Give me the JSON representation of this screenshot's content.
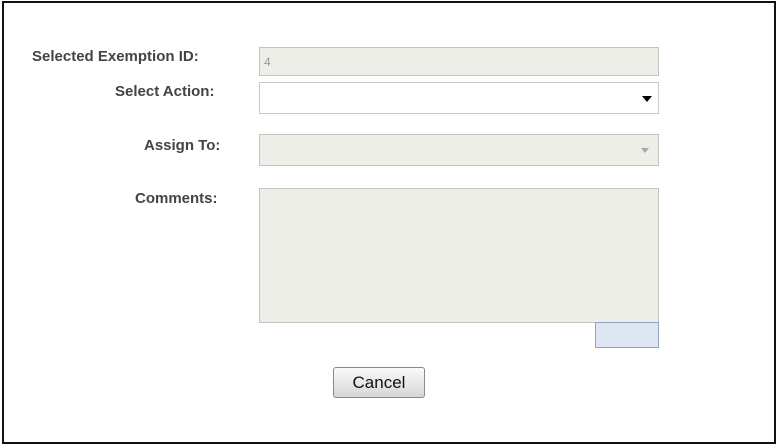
{
  "form": {
    "exemption_id": {
      "label": "Selected Exemption ID:",
      "value": "4"
    },
    "select_action": {
      "label": "Select Action:",
      "value": ""
    },
    "assign_to": {
      "label": "Assign To:",
      "value": ""
    },
    "comments": {
      "label": "Comments:",
      "value": "",
      "char_counter": ""
    },
    "cancel_label": "Cancel"
  },
  "icons": {
    "select_action_arrow": "chevron-down-icon",
    "assign_to_arrow": "chevron-down-icon"
  },
  "colors": {
    "disabled_field_bg": "#eeeee8",
    "counter_bg": "#dde6f2",
    "label_text": "#444444"
  }
}
